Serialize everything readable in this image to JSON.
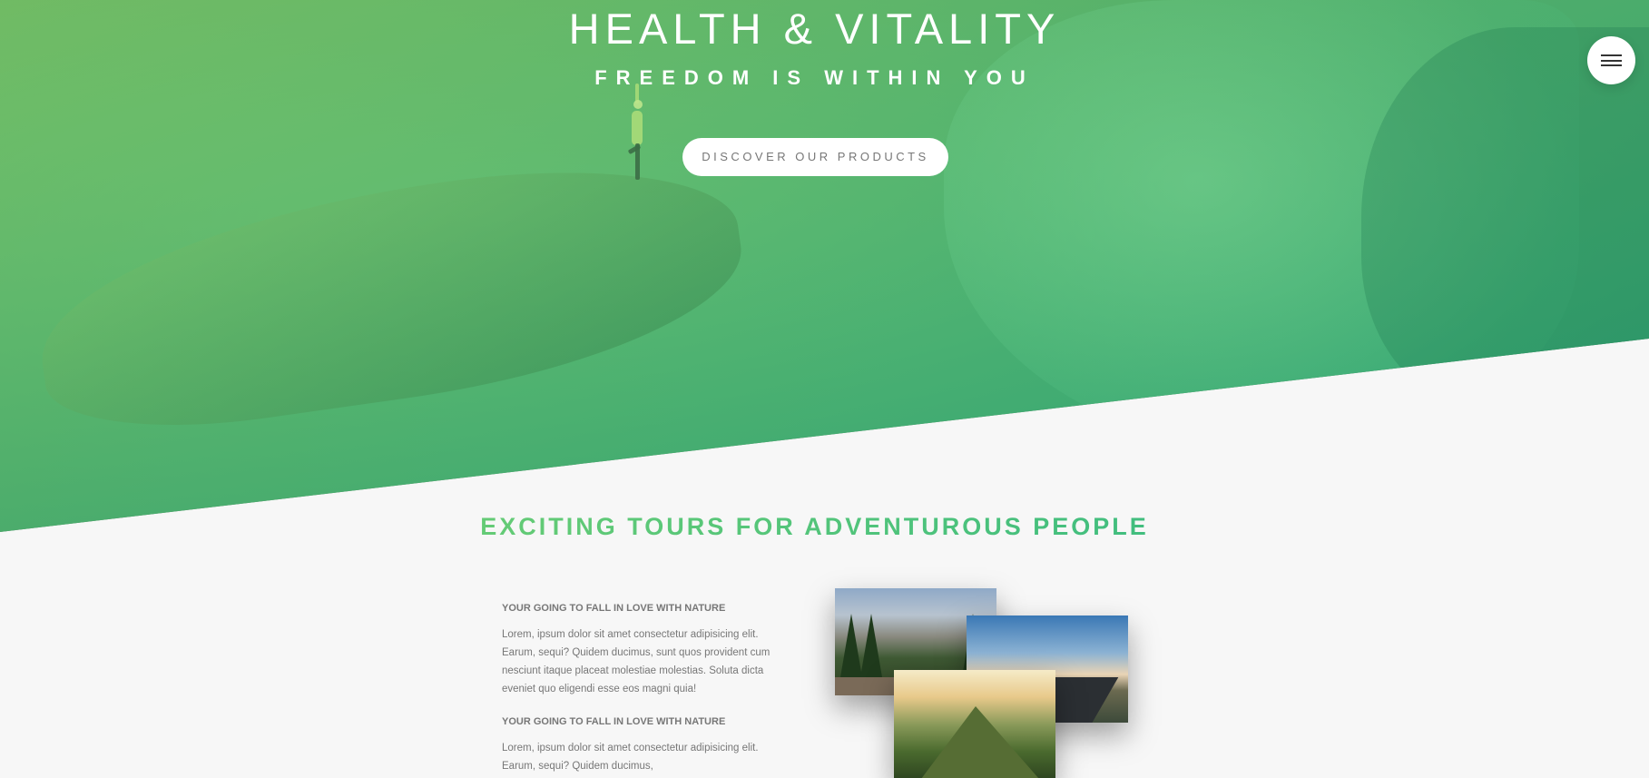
{
  "hero": {
    "title": "HEALTH & VITALITY",
    "subtitle": "FREEDOM IS WITHIN YOU",
    "cta_label": "DISCOVER OUR PRODUCTS"
  },
  "nav": {
    "menu_icon": "hamburger-menu-icon"
  },
  "section": {
    "heading": "EXCITING TOURS FOR ADVENTUROUS PEOPLE",
    "blocks": [
      {
        "title": "YOUR GOING TO FALL IN LOVE WITH NATURE",
        "text": "Lorem, ipsum dolor sit amet consectetur adipisicing elit. Earum, sequi? Quidem ducimus, sunt quos provident cum nesciunt itaque placeat molestiae molestias. Soluta dicta eveniet quo eligendi esse eos magni quia!"
      },
      {
        "title": "YOUR GOING TO FALL IN LOVE WITH NATURE",
        "text": "Lorem, ipsum dolor sit amet consectetur adipisicing elit. Earum, sequi? Quidem ducimus,"
      }
    ]
  },
  "colors": {
    "gradient_start": "#7ed56f",
    "gradient_end": "#28b485",
    "background": "#f7f7f7",
    "text": "#777777"
  }
}
